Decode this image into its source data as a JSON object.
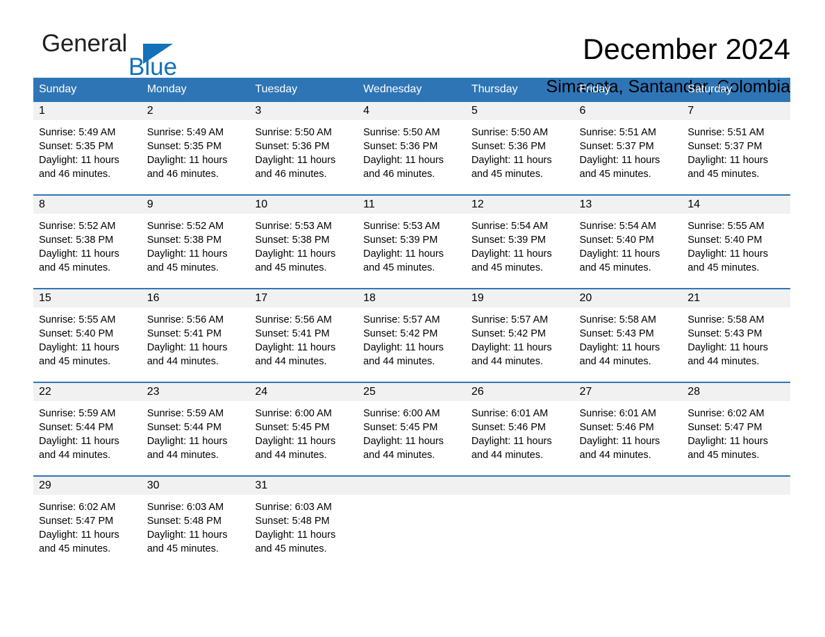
{
  "brand": {
    "name_part1": "General",
    "name_part2": "Blue",
    "triangle_color": "#1271b8",
    "logo_icon": "general-blue-triangle-icon"
  },
  "header": {
    "title": "December 2024",
    "subtitle": "Simacota, Santander, Colombia"
  },
  "theme": {
    "accent": "#2e75b6",
    "daynum_background": "#f1f1f1",
    "cell_background": "#ffffff",
    "text": "#000000"
  },
  "calendar": {
    "month": "December",
    "year": "2024",
    "location": "Simacota, Santander, Colombia",
    "weekday_headers": [
      "Sunday",
      "Monday",
      "Tuesday",
      "Wednesday",
      "Thursday",
      "Friday",
      "Saturday"
    ],
    "weeks": [
      [
        {
          "day": "1",
          "sunrise": "Sunrise: 5:49 AM",
          "sunset": "Sunset: 5:35 PM",
          "daylight": "Daylight: 11 hours and 46 minutes."
        },
        {
          "day": "2",
          "sunrise": "Sunrise: 5:49 AM",
          "sunset": "Sunset: 5:35 PM",
          "daylight": "Daylight: 11 hours and 46 minutes."
        },
        {
          "day": "3",
          "sunrise": "Sunrise: 5:50 AM",
          "sunset": "Sunset: 5:36 PM",
          "daylight": "Daylight: 11 hours and 46 minutes."
        },
        {
          "day": "4",
          "sunrise": "Sunrise: 5:50 AM",
          "sunset": "Sunset: 5:36 PM",
          "daylight": "Daylight: 11 hours and 46 minutes."
        },
        {
          "day": "5",
          "sunrise": "Sunrise: 5:50 AM",
          "sunset": "Sunset: 5:36 PM",
          "daylight": "Daylight: 11 hours and 45 minutes."
        },
        {
          "day": "6",
          "sunrise": "Sunrise: 5:51 AM",
          "sunset": "Sunset: 5:37 PM",
          "daylight": "Daylight: 11 hours and 45 minutes."
        },
        {
          "day": "7",
          "sunrise": "Sunrise: 5:51 AM",
          "sunset": "Sunset: 5:37 PM",
          "daylight": "Daylight: 11 hours and 45 minutes."
        }
      ],
      [
        {
          "day": "8",
          "sunrise": "Sunrise: 5:52 AM",
          "sunset": "Sunset: 5:38 PM",
          "daylight": "Daylight: 11 hours and 45 minutes."
        },
        {
          "day": "9",
          "sunrise": "Sunrise: 5:52 AM",
          "sunset": "Sunset: 5:38 PM",
          "daylight": "Daylight: 11 hours and 45 minutes."
        },
        {
          "day": "10",
          "sunrise": "Sunrise: 5:53 AM",
          "sunset": "Sunset: 5:38 PM",
          "daylight": "Daylight: 11 hours and 45 minutes."
        },
        {
          "day": "11",
          "sunrise": "Sunrise: 5:53 AM",
          "sunset": "Sunset: 5:39 PM",
          "daylight": "Daylight: 11 hours and 45 minutes."
        },
        {
          "day": "12",
          "sunrise": "Sunrise: 5:54 AM",
          "sunset": "Sunset: 5:39 PM",
          "daylight": "Daylight: 11 hours and 45 minutes."
        },
        {
          "day": "13",
          "sunrise": "Sunrise: 5:54 AM",
          "sunset": "Sunset: 5:40 PM",
          "daylight": "Daylight: 11 hours and 45 minutes."
        },
        {
          "day": "14",
          "sunrise": "Sunrise: 5:55 AM",
          "sunset": "Sunset: 5:40 PM",
          "daylight": "Daylight: 11 hours and 45 minutes."
        }
      ],
      [
        {
          "day": "15",
          "sunrise": "Sunrise: 5:55 AM",
          "sunset": "Sunset: 5:40 PM",
          "daylight": "Daylight: 11 hours and 45 minutes."
        },
        {
          "day": "16",
          "sunrise": "Sunrise: 5:56 AM",
          "sunset": "Sunset: 5:41 PM",
          "daylight": "Daylight: 11 hours and 44 minutes."
        },
        {
          "day": "17",
          "sunrise": "Sunrise: 5:56 AM",
          "sunset": "Sunset: 5:41 PM",
          "daylight": "Daylight: 11 hours and 44 minutes."
        },
        {
          "day": "18",
          "sunrise": "Sunrise: 5:57 AM",
          "sunset": "Sunset: 5:42 PM",
          "daylight": "Daylight: 11 hours and 44 minutes."
        },
        {
          "day": "19",
          "sunrise": "Sunrise: 5:57 AM",
          "sunset": "Sunset: 5:42 PM",
          "daylight": "Daylight: 11 hours and 44 minutes."
        },
        {
          "day": "20",
          "sunrise": "Sunrise: 5:58 AM",
          "sunset": "Sunset: 5:43 PM",
          "daylight": "Daylight: 11 hours and 44 minutes."
        },
        {
          "day": "21",
          "sunrise": "Sunrise: 5:58 AM",
          "sunset": "Sunset: 5:43 PM",
          "daylight": "Daylight: 11 hours and 44 minutes."
        }
      ],
      [
        {
          "day": "22",
          "sunrise": "Sunrise: 5:59 AM",
          "sunset": "Sunset: 5:44 PM",
          "daylight": "Daylight: 11 hours and 44 minutes."
        },
        {
          "day": "23",
          "sunrise": "Sunrise: 5:59 AM",
          "sunset": "Sunset: 5:44 PM",
          "daylight": "Daylight: 11 hours and 44 minutes."
        },
        {
          "day": "24",
          "sunrise": "Sunrise: 6:00 AM",
          "sunset": "Sunset: 5:45 PM",
          "daylight": "Daylight: 11 hours and 44 minutes."
        },
        {
          "day": "25",
          "sunrise": "Sunrise: 6:00 AM",
          "sunset": "Sunset: 5:45 PM",
          "daylight": "Daylight: 11 hours and 44 minutes."
        },
        {
          "day": "26",
          "sunrise": "Sunrise: 6:01 AM",
          "sunset": "Sunset: 5:46 PM",
          "daylight": "Daylight: 11 hours and 44 minutes."
        },
        {
          "day": "27",
          "sunrise": "Sunrise: 6:01 AM",
          "sunset": "Sunset: 5:46 PM",
          "daylight": "Daylight: 11 hours and 44 minutes."
        },
        {
          "day": "28",
          "sunrise": "Sunrise: 6:02 AM",
          "sunset": "Sunset: 5:47 PM",
          "daylight": "Daylight: 11 hours and 45 minutes."
        }
      ],
      [
        {
          "day": "29",
          "sunrise": "Sunrise: 6:02 AM",
          "sunset": "Sunset: 5:47 PM",
          "daylight": "Daylight: 11 hours and 45 minutes."
        },
        {
          "day": "30",
          "sunrise": "Sunrise: 6:03 AM",
          "sunset": "Sunset: 5:48 PM",
          "daylight": "Daylight: 11 hours and 45 minutes."
        },
        {
          "day": "31",
          "sunrise": "Sunrise: 6:03 AM",
          "sunset": "Sunset: 5:48 PM",
          "daylight": "Daylight: 11 hours and 45 minutes."
        },
        {
          "day": "",
          "sunrise": "",
          "sunset": "",
          "daylight": ""
        },
        {
          "day": "",
          "sunrise": "",
          "sunset": "",
          "daylight": ""
        },
        {
          "day": "",
          "sunrise": "",
          "sunset": "",
          "daylight": ""
        },
        {
          "day": "",
          "sunrise": "",
          "sunset": "",
          "daylight": ""
        }
      ]
    ]
  }
}
